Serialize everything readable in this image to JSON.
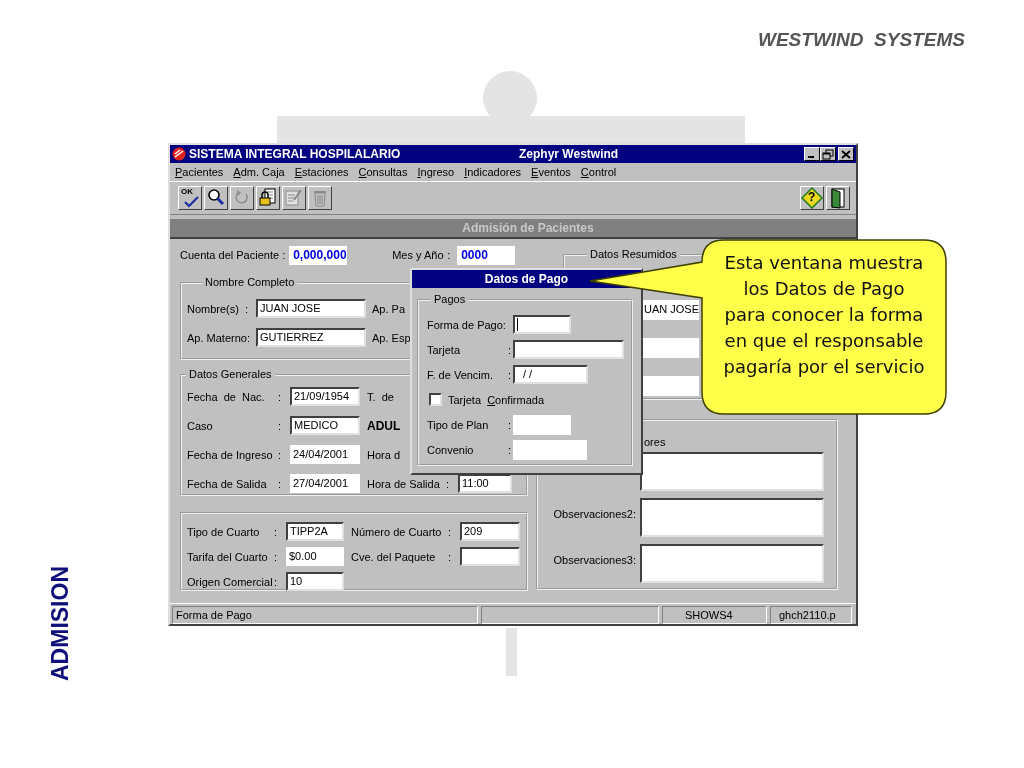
{
  "slide": {
    "header": "WESTWIND  SYSTEMS",
    "side_label": "ADMISION"
  },
  "window": {
    "title": "SISTEMA INTEGRAL HOSPILALARIO",
    "subtitle": "Zephyr Westwind"
  },
  "menu": [
    {
      "label": "Pacientes"
    },
    {
      "label": "Adm. Caja"
    },
    {
      "label": "Estaciones"
    },
    {
      "label": "Consultas"
    },
    {
      "label": "Ingreso"
    },
    {
      "label": "Indicadores"
    },
    {
      "label": "Eventos"
    },
    {
      "label": "Control"
    }
  ],
  "toolbar": {
    "left": [
      {
        "kind": "ok",
        "label": "OK",
        "disabled": false
      },
      {
        "kind": "search",
        "disabled": false
      },
      {
        "kind": "undo",
        "disabled": true
      },
      {
        "kind": "lock",
        "disabled": false
      },
      {
        "kind": "edit",
        "disabled": true
      },
      {
        "kind": "trash",
        "disabled": true
      }
    ],
    "right": [
      {
        "kind": "help",
        "label": "?",
        "disabled": false
      },
      {
        "kind": "exit",
        "disabled": false
      }
    ]
  },
  "section_title": "Admisión de Pacientes",
  "account": [
    {
      "kind": "label",
      "text": "Cuenta del Paciente :"
    },
    {
      "kind": "blue",
      "value": "0,000,000"
    },
    {
      "kind": "label",
      "text": "Mes y Año",
      "sep": ":"
    },
    {
      "kind": "blue",
      "value": "0000"
    }
  ],
  "name_group": {
    "legend": "Nombre Completo",
    "rows": [
      [
        {
          "kind": "label",
          "text": "Nombre(s)",
          "sep": ":"
        },
        {
          "kind": "field",
          "value": "JUAN JOSE"
        },
        {
          "kind": "label",
          "text": "Ap. Pa"
        }
      ],
      [
        {
          "kind": "label",
          "text": "Ap. Materno:"
        },
        {
          "kind": "field",
          "value": "GUTIERREZ"
        },
        {
          "kind": "label",
          "text": "Ap. Esp"
        }
      ]
    ]
  },
  "general_group": {
    "legend": "Datos Generales",
    "rows": [
      [
        {
          "kind": "label",
          "text": "Fecha  de  Nac.",
          "sep": ":"
        },
        {
          "kind": "field",
          "value": "21/09/1954"
        },
        {
          "kind": "label",
          "text": "T.  de"
        }
      ],
      [
        {
          "kind": "label",
          "text": "Caso",
          "sep": ":"
        },
        {
          "kind": "field",
          "value": "MEDICO"
        },
        {
          "kind": "bold",
          "text": "ADUL"
        }
      ],
      [
        {
          "kind": "label",
          "text": "Fecha de Ingreso",
          "sep": ":"
        },
        {
          "kind": "flat",
          "value": "24/04/2001"
        },
        {
          "kind": "label",
          "text": "Hora d"
        }
      ],
      [
        {
          "kind": "label",
          "text": "Fecha de Salida",
          "sep": ":"
        },
        {
          "kind": "flat",
          "value": "27/04/2001"
        },
        {
          "kind": "label",
          "text": "Hora de Salida",
          "sep": ":"
        },
        {
          "kind": "field",
          "value": "11:00"
        }
      ]
    ]
  },
  "room_group": {
    "rows": [
      [
        {
          "kind": "label",
          "text": "Tipo de Cuarto",
          "sep": ":"
        },
        {
          "kind": "field",
          "value": "TIPP2A"
        },
        {
          "kind": "label",
          "text": "Número de Cuarto",
          "sep": ":"
        },
        {
          "kind": "field",
          "value": "209"
        }
      ],
      [
        {
          "kind": "label",
          "text": "Tarifa del Cuarto",
          "sep": ":"
        },
        {
          "kind": "flat",
          "value": "$0.00"
        },
        {
          "kind": "label",
          "text": "Cve. del Paquete",
          "sep": ":"
        },
        {
          "kind": "field"
        }
      ],
      [
        {
          "kind": "label",
          "text": "Origen Comercial",
          "sep": ":"
        },
        {
          "kind": "field",
          "value": "10"
        }
      ]
    ]
  },
  "summary_group": {
    "legend": "Datos Resumidos",
    "fields": [
      {
        "kind": "filled",
        "value": "UAN JOSE"
      },
      {
        "kind": "blank"
      },
      {
        "kind": "blank"
      }
    ]
  },
  "notes_group": {
    "rows": [
      {
        "kind": "top",
        "label": "ores"
      },
      {
        "kind": "side",
        "label": "Observaciones2:"
      },
      {
        "kind": "side",
        "label": "Observaciones3:"
      }
    ]
  },
  "payment_dialog": {
    "title": "Datos de Pago",
    "legend": "Pagos",
    "rows": [
      {
        "kind": "field",
        "label": "Forma de Pago:",
        "focused": true
      },
      {
        "kind": "field",
        "label": "Tarjeta",
        "sep": ":",
        "focused": false
      },
      {
        "kind": "field",
        "label": "F. de Vencim.",
        "sep": ":",
        "value": "/ /",
        "focused": false
      },
      {
        "kind": "checkbox",
        "label": "Tarjeta  Confirmada",
        "checked": false
      },
      {
        "kind": "flat",
        "label": "Tipo de Plan",
        "sep": ":"
      },
      {
        "kind": "flat",
        "label": "Convenio",
        "sep": ":"
      }
    ]
  },
  "status_bar": [
    {
      "kind": "text",
      "text": "Forma de Pago"
    },
    {
      "kind": "blank"
    },
    {
      "kind": "text",
      "text": "SHOWS4"
    },
    {
      "kind": "text",
      "text": "ghch2110.p"
    }
  ],
  "callout": {
    "text": "Esta ventana muestra los Datos de Pago para conocer la forma en que el responsable pagaría por el servicio"
  }
}
